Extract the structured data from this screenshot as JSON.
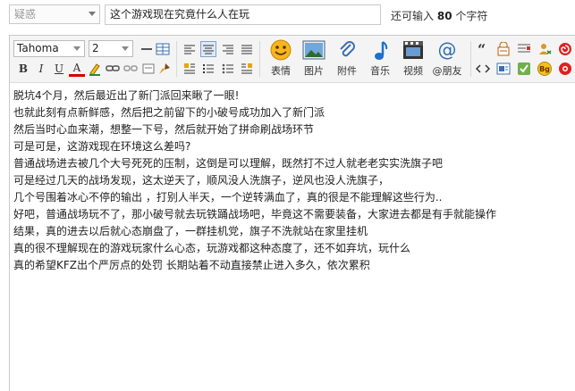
{
  "category": {
    "selected": "疑惑"
  },
  "title": {
    "value": "这个游戏现在究竟什么人在玩"
  },
  "char_hint": {
    "prefix": "还可输入",
    "count": "80",
    "suffix": "个字符"
  },
  "toolbar": {
    "font": "Tahoma",
    "size": "2",
    "bold": "B",
    "italic": "I",
    "underline": "U",
    "font_color": "A",
    "buttons": [
      {
        "label": "表情",
        "icon": "smiley-icon"
      },
      {
        "label": "图片",
        "icon": "image-icon"
      },
      {
        "label": "附件",
        "icon": "paperclip-icon"
      },
      {
        "label": "音乐",
        "icon": "music-note-icon"
      },
      {
        "label": "视频",
        "icon": "video-icon"
      },
      {
        "label": "@朋友",
        "icon": "at-icon"
      }
    ],
    "bg_label": "Bg"
  },
  "content": {
    "lines": [
      "脱坑4个月，然后最近出了新门派回来瞅了一眼!",
      "也就此刻有点新鲜感，然后把之前留下的小破号成功加入了新门派",
      "然后当时心血来潮，想整一下号，然后就开始了拼命刷战场环节",
      "可是可是，这游戏现在环境这么差吗?",
      "普通战场进去被几个大号死死的压制，这倒是可以理解，既然打不过人就老老实实洗旗子吧",
      "可是经过几天的战场发现，这太逆天了，顺风没人洗旗子，逆风也没人洗旗子，",
      "几个号围着冰心不停的输出 ，打别人半天，一个逆转满血了，真的很是不能理解这些行为..",
      "好吧，普通战场玩不了，那小破号就去玩铁踊战场吧，毕竟这不需要装备，大家进去都是有手就能操作",
      "结果，真的进去以后就心态崩盘了，一群挂机党，旗子不洗就站在家里挂机",
      "真的很不理解现在的游戏玩家什么心态，玩游戏都这种态度了，还不如弃坑，玩什么",
      "真的希望KFZ出个严厉点的处罚 长期站着不动直接禁止进入多久，依次累积"
    ]
  },
  "colors": {
    "border": "#c9c9c9",
    "toolbar_bg": "#f4f4f4",
    "active": "#dfe9f6",
    "music": "#1e6fd0",
    "at": "#2e6db4"
  }
}
